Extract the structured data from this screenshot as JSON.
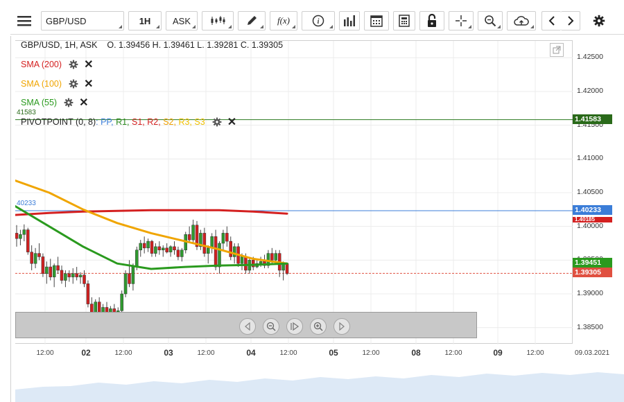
{
  "toolbar": {
    "menu_icon": "hamburger-icon",
    "symbol": "GBP/USD",
    "timeframe": "1H",
    "price_side": "ASK",
    "chart_type_icon": "candlestick-icon",
    "draw_icon": "pencil-icon",
    "function_icon": "f(x)",
    "info_icon": "info-icon",
    "volume_icon": "bar-chart-icon",
    "calendar_icon": "calendar-icon",
    "calculator_icon": "calculator-icon",
    "lock_icon": "lock-icon",
    "crosshair_icon": "crosshair-icon",
    "zoom_icon": "zoom-icon",
    "upload_icon": "cloud-upload-icon",
    "prev_icon": "chevron-left-icon",
    "next_icon": "chevron-right-icon",
    "settings_icon": "gear-icon"
  },
  "legend": {
    "header": "GBP/USD, 1H, ASK    O. 1.39456 H. 1.39461 L. 1.39281 C. 1.39305",
    "sma200": "SMA (200)",
    "sma100": "SMA (100)",
    "sma55": "SMA (55)",
    "pivot_prefix": "PIVOTPOINT (0, 8)",
    "pivot_items": [
      {
        "text": " : PP,",
        "color": "#3b7dd8"
      },
      {
        "text": " R1,",
        "color": "#2a8a1e"
      },
      {
        "text": " S1,",
        "color": "#d42020"
      },
      {
        "text": " R2,",
        "color": "#d42020"
      },
      {
        "text": " S2,",
        "color": "#f0a000"
      },
      {
        "text": " R3,",
        "color": "#f0c000"
      },
      {
        "text": " S3",
        "color": "#f0c000"
      }
    ],
    "r1_left_label": "41583",
    "pp_left_label": "40233"
  },
  "colors": {
    "sma200": "#d42020",
    "sma100": "#f0a500",
    "sma55": "#2a9a1e",
    "pp": "#3b7dd8",
    "r1": "#2a7a1e",
    "close": "#e05040",
    "candle_up": "#2f9a2f",
    "candle_down": "#d02020"
  },
  "price_axis": {
    "ticks": [
      "1.42500",
      "1.42000",
      "1.41500",
      "1.41000",
      "1.40500",
      "1.40000",
      "1.39500",
      "1.39000",
      "1.38500"
    ],
    "labels": [
      {
        "text": "1.41583",
        "value": 1.41583,
        "color": "#2a6a1a"
      },
      {
        "text": "1.40233",
        "value": 1.40233,
        "color": "#3b7dd8"
      },
      {
        "text": "1.39451",
        "value": 1.39451,
        "color": "#2a9a1e"
      },
      {
        "text": "1.39305",
        "value": 1.39305,
        "color": "#e05040"
      }
    ],
    "hidden_label": "1.40185",
    "range": [
      1.3825,
      1.4275
    ]
  },
  "time_axis": {
    "ticks": [
      {
        "label": "12:00",
        "bold": false
      },
      {
        "label": "02",
        "bold": true
      },
      {
        "label": "12:00",
        "bold": false
      },
      {
        "label": "03",
        "bold": true
      },
      {
        "label": "12:00",
        "bold": false
      },
      {
        "label": "04",
        "bold": true
      },
      {
        "label": "12:00",
        "bold": false
      },
      {
        "label": "05",
        "bold": true
      },
      {
        "label": "12:00",
        "bold": false
      },
      {
        "label": "08",
        "bold": true
      },
      {
        "label": "12:00",
        "bold": false
      },
      {
        "label": "09",
        "bold": true
      },
      {
        "label": "12:00",
        "bold": false
      },
      {
        "label": "09.03.2021",
        "bold": false
      }
    ]
  },
  "navigation": {
    "buttons": [
      "chevron-left-icon",
      "zoom-out-icon",
      "reset-icon",
      "zoom-in-icon",
      "chevron-right-icon"
    ]
  },
  "chart_data": {
    "type": "candlestick",
    "title": "",
    "series": [
      {
        "name": "SMA (200)",
        "values": [
          1.4017,
          1.402,
          1.4022,
          1.4023,
          1.4024,
          1.4024,
          1.4024,
          1.4022,
          1.4019
        ]
      },
      {
        "name": "SMA (100)",
        "values": [
          1.4068,
          1.405,
          1.4025,
          1.4005,
          1.399,
          1.3978,
          1.3966,
          1.3952,
          1.3945
        ]
      },
      {
        "name": "SMA (55)",
        "values": [
          1.403,
          1.4,
          1.397,
          1.3945,
          1.3937,
          1.394,
          1.3942,
          1.3943,
          1.3945
        ]
      }
    ],
    "pivot": {
      "PP": 1.40233,
      "R1": 1.41583
    },
    "last_close": 1.39305,
    "ylim": [
      1.3825,
      1.4275
    ],
    "candles": [
      [
        1.399,
        1.4002,
        1.397,
        1.3982
      ],
      [
        1.3982,
        1.3995,
        1.3972,
        1.3988
      ],
      [
        1.3988,
        1.4003,
        1.3978,
        1.3995
      ],
      [
        1.3995,
        1.3998,
        1.3958,
        1.3962
      ],
      [
        1.3962,
        1.3972,
        1.3935,
        1.3945
      ],
      [
        1.3945,
        1.3968,
        1.3938,
        1.396
      ],
      [
        1.396,
        1.3975,
        1.395,
        1.3955
      ],
      [
        1.3955,
        1.396,
        1.3925,
        1.393
      ],
      [
        1.393,
        1.3948,
        1.3915,
        1.394
      ],
      [
        1.394,
        1.3952,
        1.392,
        1.3925
      ],
      [
        1.3925,
        1.3945,
        1.391,
        1.3942
      ],
      [
        1.3942,
        1.3955,
        1.393,
        1.3935
      ],
      [
        1.3935,
        1.3942,
        1.3915,
        1.392
      ],
      [
        1.392,
        1.3935,
        1.391,
        1.393
      ],
      [
        1.393,
        1.3935,
        1.3918,
        1.3925
      ],
      [
        1.3925,
        1.3938,
        1.3915,
        1.393
      ],
      [
        1.393,
        1.394,
        1.392,
        1.3925
      ],
      [
        1.3925,
        1.3932,
        1.3915,
        1.3928
      ],
      [
        1.3928,
        1.3935,
        1.391,
        1.3915
      ],
      [
        1.3915,
        1.392,
        1.388,
        1.3885
      ],
      [
        1.3885,
        1.3895,
        1.386,
        1.387
      ],
      [
        1.387,
        1.3892,
        1.3865,
        1.3888
      ],
      [
        1.3888,
        1.3895,
        1.3862,
        1.3868
      ],
      [
        1.3868,
        1.3885,
        1.386,
        1.388
      ],
      [
        1.388,
        1.3888,
        1.3865,
        1.387
      ],
      [
        1.387,
        1.3882,
        1.3858,
        1.3878
      ],
      [
        1.3878,
        1.3885,
        1.386,
        1.3865
      ],
      [
        1.3865,
        1.388,
        1.3855,
        1.3875
      ],
      [
        1.3875,
        1.3905,
        1.387,
        1.39
      ],
      [
        1.39,
        1.3935,
        1.3895,
        1.393
      ],
      [
        1.393,
        1.395,
        1.391,
        1.3915
      ],
      [
        1.3915,
        1.3945,
        1.3905,
        1.394
      ],
      [
        1.394,
        1.397,
        1.3935,
        1.3965
      ],
      [
        1.3965,
        1.398,
        1.3955,
        1.3975
      ],
      [
        1.3975,
        1.3985,
        1.396,
        1.3968
      ],
      [
        1.3968,
        1.3982,
        1.3962,
        1.3978
      ],
      [
        1.3978,
        1.398,
        1.3955,
        1.396
      ],
      [
        1.396,
        1.3975,
        1.3955,
        1.397
      ],
      [
        1.397,
        1.3978,
        1.3958,
        1.3965
      ],
      [
        1.3965,
        1.3972,
        1.3955,
        1.3968
      ],
      [
        1.3968,
        1.3975,
        1.396,
        1.3962
      ],
      [
        1.3962,
        1.3972,
        1.3955,
        1.397
      ],
      [
        1.397,
        1.3978,
        1.3958,
        1.3965
      ],
      [
        1.3965,
        1.397,
        1.395,
        1.3955
      ],
      [
        1.3955,
        1.3968,
        1.3948,
        1.3965
      ],
      [
        1.3965,
        1.3992,
        1.396,
        1.3988
      ],
      [
        1.3988,
        1.4,
        1.3975,
        1.398
      ],
      [
        1.398,
        1.401,
        1.3975,
        1.4002
      ],
      [
        1.4002,
        1.4008,
        1.3965,
        1.397
      ],
      [
        1.397,
        1.3995,
        1.3965,
        1.399
      ],
      [
        1.399,
        1.3998,
        1.3955,
        1.396
      ],
      [
        1.396,
        1.3972,
        1.3945,
        1.3968
      ],
      [
        1.3968,
        1.399,
        1.396,
        1.3985
      ],
      [
        1.3985,
        1.3995,
        1.3935,
        1.394
      ],
      [
        1.394,
        1.3978,
        1.393,
        1.3975
      ],
      [
        1.3975,
        1.3995,
        1.3965,
        1.399
      ],
      [
        1.399,
        1.4,
        1.397,
        1.3978
      ],
      [
        1.3978,
        1.3985,
        1.395,
        1.3955
      ],
      [
        1.3955,
        1.3975,
        1.3945,
        1.397
      ],
      [
        1.397,
        1.3975,
        1.394,
        1.3945
      ],
      [
        1.3945,
        1.396,
        1.3935,
        1.3955
      ],
      [
        1.3955,
        1.396,
        1.393,
        1.3935
      ],
      [
        1.3935,
        1.3955,
        1.393,
        1.395
      ],
      [
        1.395,
        1.3955,
        1.3935,
        1.394
      ],
      [
        1.394,
        1.395,
        1.3938,
        1.3945
      ],
      [
        1.3945,
        1.3955,
        1.394,
        1.3948
      ],
      [
        1.3948,
        1.3958,
        1.3938,
        1.3942
      ],
      [
        1.3942,
        1.3965,
        1.3938,
        1.396
      ],
      [
        1.396,
        1.3968,
        1.3945,
        1.395
      ],
      [
        1.395,
        1.3965,
        1.3945,
        1.396
      ],
      [
        1.396,
        1.3965,
        1.3925,
        1.3935
      ],
      [
        1.3935,
        1.3948,
        1.392,
        1.3945
      ],
      [
        1.3945,
        1.3946,
        1.3928,
        1.393
      ]
    ]
  }
}
